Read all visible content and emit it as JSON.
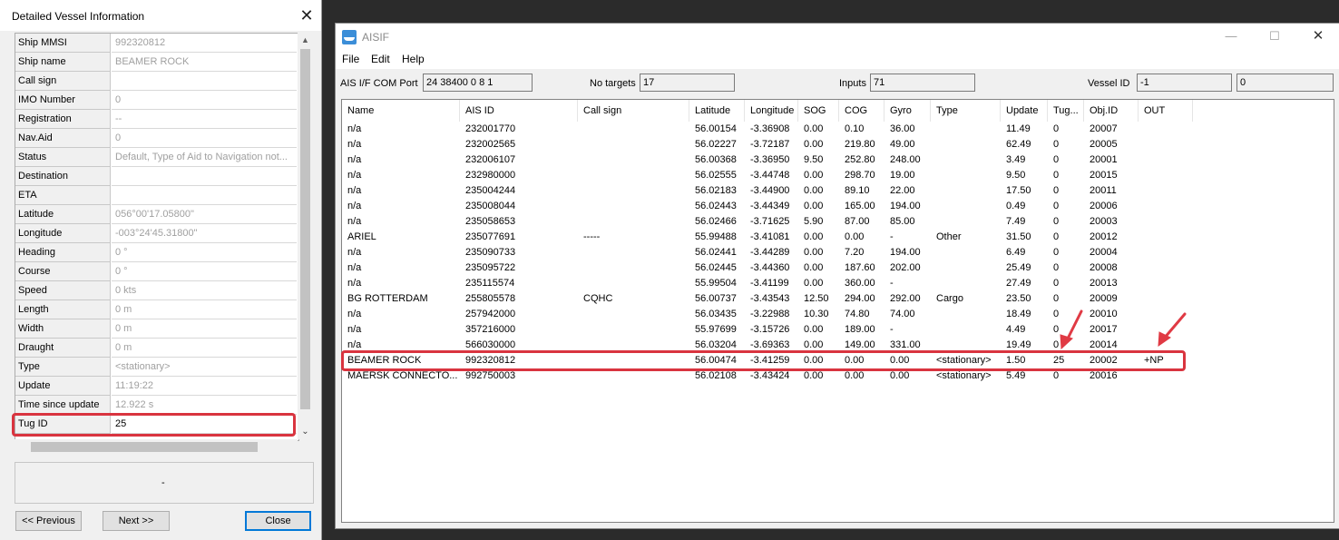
{
  "dialog": {
    "title": "Detailed Vessel Information",
    "properties": [
      {
        "label": "Ship MMSI",
        "value": "992320812"
      },
      {
        "label": "Ship name",
        "value": "BEAMER ROCK"
      },
      {
        "label": "Call sign",
        "value": ""
      },
      {
        "label": "IMO Number",
        "value": "0"
      },
      {
        "label": "Registration",
        "value": "--"
      },
      {
        "label": "Nav.Aid",
        "value": "0"
      },
      {
        "label": "Status",
        "value": "Default, Type of Aid to Navigation not..."
      },
      {
        "label": "Destination",
        "value": ""
      },
      {
        "label": "ETA",
        "value": ""
      },
      {
        "label": "Latitude",
        "value": " 056°00'17.05800\""
      },
      {
        "label": "Longitude",
        "value": "-003°24'45.31800\""
      },
      {
        "label": "Heading",
        "value": "0 °"
      },
      {
        "label": "Course",
        "value": "0 °"
      },
      {
        "label": "Speed",
        "value": "0 kts"
      },
      {
        "label": "Length",
        "value": "0 m"
      },
      {
        "label": "Width",
        "value": "0 m"
      },
      {
        "label": "Draught",
        "value": "0 m"
      },
      {
        "label": "Type",
        "value": "<stationary>"
      },
      {
        "label": "Update",
        "value": "11:19:22"
      },
      {
        "label": "Time since update",
        "value": "12.922 s"
      },
      {
        "label": "Tug ID",
        "value": "25"
      }
    ],
    "description": "-",
    "buttons": {
      "previous": "<< Previous",
      "next": "Next >>",
      "close": "Close"
    }
  },
  "aisif": {
    "title": "AISIF",
    "menu": [
      "File",
      "Edit",
      "Help"
    ],
    "toolbar": {
      "ais_label": "AIS I/F  COM Port",
      "ais_value": "24 38400 0 8 1",
      "targets_label": "No targets",
      "targets_value": "17",
      "inputs_label": "Inputs",
      "inputs_value": "71",
      "vessel_label": "Vessel ID",
      "vessel_value": "-1",
      "extra_value": "0"
    },
    "columns": [
      "Name",
      "AIS ID",
      "Call sign",
      "Latitude",
      "Longitude",
      "SOG",
      "COG",
      "Gyro",
      "Type",
      "Update",
      "Tug...",
      "Obj.ID",
      "OUT"
    ],
    "rows": [
      [
        "n/a",
        "232001770",
        "",
        "56.00154",
        "-3.36908",
        "0.00",
        "0.10",
        "36.00",
        "",
        "11.49",
        "0",
        "20007",
        ""
      ],
      [
        "n/a",
        "232002565",
        "",
        "56.02227",
        "-3.72187",
        "0.00",
        "219.80",
        "49.00",
        "",
        "62.49",
        "0",
        "20005",
        ""
      ],
      [
        "n/a",
        "232006107",
        "",
        "56.00368",
        "-3.36950",
        "9.50",
        "252.80",
        "248.00",
        "",
        "3.49",
        "0",
        "20001",
        ""
      ],
      [
        "n/a",
        "232980000",
        "",
        "56.02555",
        "-3.44748",
        "0.00",
        "298.70",
        "19.00",
        "",
        "9.50",
        "0",
        "20015",
        ""
      ],
      [
        "n/a",
        "235004244",
        "",
        "56.02183",
        "-3.44900",
        "0.00",
        "89.10",
        "22.00",
        "",
        "17.50",
        "0",
        "20011",
        ""
      ],
      [
        "n/a",
        "235008044",
        "",
        "56.02443",
        "-3.44349",
        "0.00",
        "165.00",
        "194.00",
        "",
        "0.49",
        "0",
        "20006",
        ""
      ],
      [
        "n/a",
        "235058653",
        "",
        "56.02466",
        "-3.71625",
        "5.90",
        "87.00",
        "85.00",
        "",
        "7.49",
        "0",
        "20003",
        ""
      ],
      [
        "ARIEL",
        "235077691",
        "-----",
        "55.99488",
        "-3.41081",
        "0.00",
        "0.00",
        "-",
        "Other",
        "31.50",
        "0",
        "20012",
        ""
      ],
      [
        "n/a",
        "235090733",
        "",
        "56.02441",
        "-3.44289",
        "0.00",
        "7.20",
        "194.00",
        "",
        "6.49",
        "0",
        "20004",
        ""
      ],
      [
        "n/a",
        "235095722",
        "",
        "56.02445",
        "-3.44360",
        "0.00",
        "187.60",
        "202.00",
        "",
        "25.49",
        "0",
        "20008",
        ""
      ],
      [
        "n/a",
        "235115574",
        "",
        "55.99504",
        "-3.41199",
        "0.00",
        "360.00",
        "-",
        "",
        "27.49",
        "0",
        "20013",
        ""
      ],
      [
        "BG ROTTERDAM",
        "255805578",
        "CQHC",
        "56.00737",
        "-3.43543",
        "12.50",
        "294.00",
        "292.00",
        "Cargo",
        "23.50",
        "0",
        "20009",
        ""
      ],
      [
        "n/a",
        "257942000",
        "",
        "56.03435",
        "-3.22988",
        "10.30",
        "74.80",
        "74.00",
        "",
        "18.49",
        "0",
        "20010",
        ""
      ],
      [
        "n/a",
        "357216000",
        "",
        "55.97699",
        "-3.15726",
        "0.00",
        "189.00",
        "-",
        "",
        "4.49",
        "0",
        "20017",
        ""
      ],
      [
        "n/a",
        "566030000",
        "",
        "56.03204",
        "-3.69363",
        "0.00",
        "149.00",
        "331.00",
        "",
        "19.49",
        "0",
        "20014",
        ""
      ],
      [
        "BEAMER ROCK",
        "992320812",
        "",
        "56.00474",
        "-3.41259",
        "0.00",
        "0.00",
        "0.00",
        "<stationary>",
        "1.50",
        "25",
        "20002",
        "+NP"
      ],
      [
        "MAERSK CONNECTO...",
        "992750003",
        "",
        "56.02108",
        "-3.43424",
        "0.00",
        "0.00",
        "0.00",
        "<stationary>",
        "5.49",
        "0",
        "20016",
        ""
      ]
    ]
  },
  "colors": {
    "highlight": "#d9343f",
    "selection_border": "#0078d7"
  }
}
